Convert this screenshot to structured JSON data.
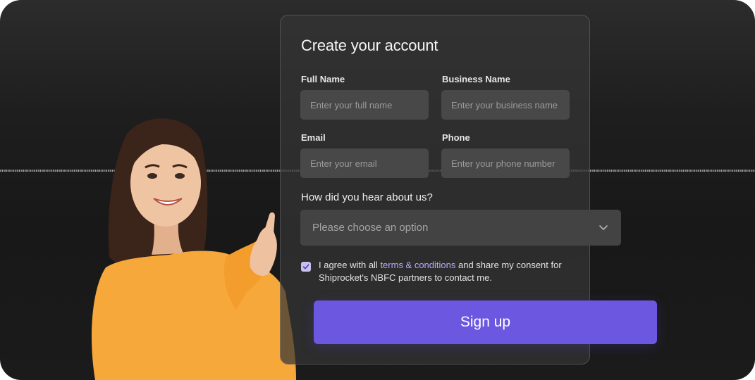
{
  "form": {
    "title": "Create your account",
    "full_name": {
      "label": "Full Name",
      "placeholder": "Enter your full name"
    },
    "business_name": {
      "label": "Business Name",
      "placeholder": "Enter your business name"
    },
    "email": {
      "label": "Email",
      "placeholder": "Enter your email"
    },
    "phone": {
      "label": "Phone",
      "placeholder": "Enter your phone number"
    },
    "source": {
      "label": "How did you hear about us?",
      "placeholder": "Please choose an option"
    },
    "consent": {
      "checked": true,
      "prefix": "I agree with all ",
      "link": "terms & conditions",
      "suffix": " and share my consent for Shiprocket's NBFC partners to contact me."
    },
    "submit_label": "Sign up"
  },
  "icons": {
    "chevron": "chevron-down-icon",
    "check": "check-icon"
  },
  "colors": {
    "accent": "#6c57e0",
    "link": "#b8a9ff",
    "checkbox": "#c9c0f2",
    "sweater": "#f6a83a"
  }
}
